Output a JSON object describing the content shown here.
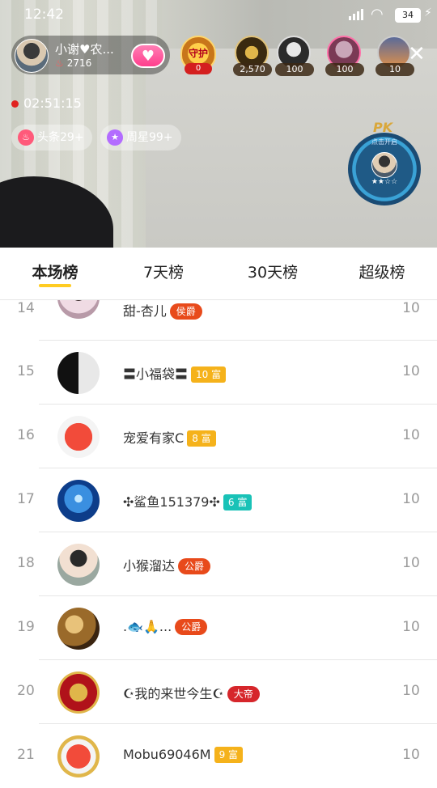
{
  "status_bar": {
    "time": "12:42",
    "battery": "34"
  },
  "host": {
    "name": "小谢♥农...",
    "fans": "2716"
  },
  "guard": {
    "label": "守护",
    "count": "0"
  },
  "viewers": [
    {
      "count": "2,570",
      "color": "#3a2a10"
    },
    {
      "count": "100",
      "color": "#2b2b2b"
    },
    {
      "count": "100",
      "color": "#7a3a55"
    },
    {
      "count": "10",
      "color": "#a86a2a"
    }
  ],
  "timer": "02:51:15",
  "tags": [
    {
      "label": "头条29+",
      "color": "#ff5a7a"
    },
    {
      "label": "周星99+",
      "color": "#b36cff"
    }
  ],
  "pk": {
    "title": "PK",
    "hint": "点击开启",
    "stars": "★★☆☆"
  },
  "tabs": [
    "本场榜",
    "7天榜",
    "30天榜",
    "超级榜"
  ],
  "list": [
    {
      "rank": "14",
      "name": "甜-杏儿",
      "badge": "侯爵",
      "badge_type": "duke",
      "score": "10",
      "avatar_color": "#e8d6e4"
    },
    {
      "rank": "15",
      "name": "〓小福袋〓",
      "badge": "10 富",
      "badge_type": "gold",
      "score": "10",
      "avatar_color": "#1a1a1a"
    },
    {
      "rank": "16",
      "name": "宠爱有家C",
      "badge": "8 富",
      "badge_type": "gold",
      "score": "10",
      "avatar_color": "#f24b3a"
    },
    {
      "rank": "17",
      "name": "✣鲨鱼151379✣",
      "badge": "6 富",
      "badge_type": "teal",
      "score": "10",
      "avatar_color": "#1e6fd1"
    },
    {
      "rank": "18",
      "name": "小猴溜达",
      "badge": "公爵",
      "badge_type": "duke",
      "score": "10",
      "avatar_color": "#c8b8a8"
    },
    {
      "rank": "19",
      "name": ".🐟🙏...",
      "badge": "公爵",
      "badge_type": "duke",
      "score": "10",
      "avatar_color": "#9a6a2a"
    },
    {
      "rank": "20",
      "name": "☪我的来世今生☪",
      "badge": "大帝",
      "badge_type": "emperor",
      "score": "10",
      "avatar_color": "#b0121a"
    },
    {
      "rank": "21",
      "name": "Mobu69046M",
      "badge": "9 富",
      "badge_type": "gold",
      "score": "10",
      "avatar_color": "#f24b3a"
    }
  ]
}
